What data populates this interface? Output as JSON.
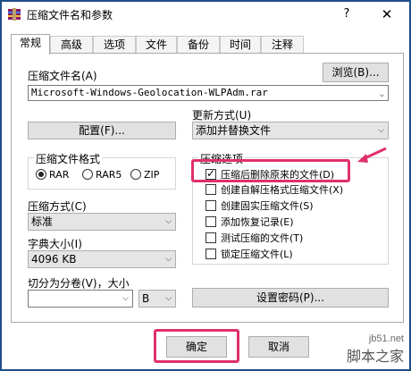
{
  "window": {
    "title": "压缩文件名和参数",
    "help": "?",
    "close": "✕"
  },
  "tabs": [
    {
      "label": "常规"
    },
    {
      "label": "高级"
    },
    {
      "label": "选项"
    },
    {
      "label": "文件"
    },
    {
      "label": "备份"
    },
    {
      "label": "时间"
    },
    {
      "label": "注释"
    }
  ],
  "archive_name": {
    "label": "压缩文件名(A)",
    "browse": "浏览(B)...",
    "value": "Microsoft-Windows-Geolocation-WLPAdm.rar"
  },
  "profile_button": "配置(F)...",
  "update_mode": {
    "label": "更新方式(U)",
    "value": "添加并替换文件"
  },
  "format": {
    "label": "压缩文件格式",
    "options": [
      {
        "label": "RAR",
        "checked": true
      },
      {
        "label": "RAR5",
        "checked": false
      },
      {
        "label": "ZIP",
        "checked": false
      }
    ]
  },
  "method": {
    "label": "压缩方式(C)",
    "value": "标准"
  },
  "dictionary": {
    "label": "字典大小(I)",
    "value": "4096 KB"
  },
  "split": {
    "label": "切分为分卷(V)，大小",
    "value": "",
    "unit": "B"
  },
  "options": {
    "title": "压缩选项",
    "items": [
      {
        "label": "压缩后删除原来的文件(D)",
        "checked": true
      },
      {
        "label": "创建自解压格式压缩文件(X)",
        "checked": false
      },
      {
        "label": "创建固实压缩文件(S)",
        "checked": false
      },
      {
        "label": "添加恢复记录(E)",
        "checked": false
      },
      {
        "label": "测试压缩的文件(T)",
        "checked": false
      },
      {
        "label": "锁定压缩文件(L)",
        "checked": false
      }
    ]
  },
  "password_button": "设置密码(P)...",
  "buttons": {
    "ok": "确定",
    "cancel": "取消"
  },
  "watermark": {
    "line1": "jb51.net",
    "line2": "脚本之家"
  },
  "colors": {
    "highlight": "#e0306b",
    "frame": "#1f4e8a",
    "app_icon": "#8b1a6b"
  }
}
